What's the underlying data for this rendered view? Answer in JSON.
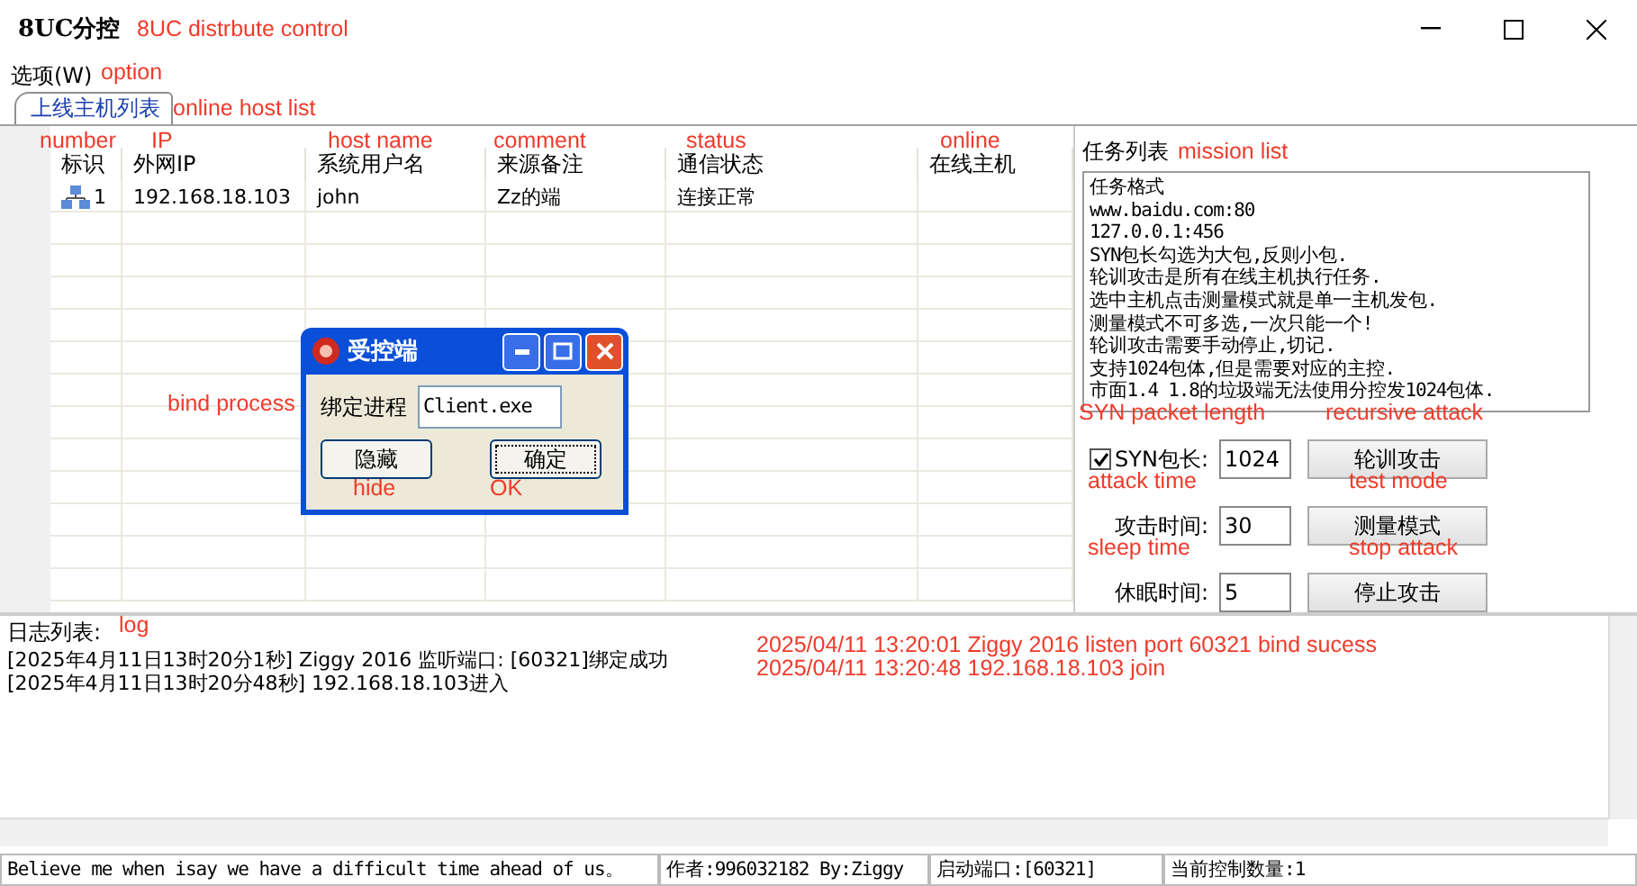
{
  "window": {
    "title": "8UC分控"
  },
  "menu": [
    "选项(W)"
  ],
  "tabs": [
    {
      "label": "上线主机列表",
      "selected": true
    }
  ],
  "table": {
    "columns": [
      "标识",
      "外网IP",
      "系统用户名",
      "来源备注",
      "通信状态",
      "在线主机"
    ],
    "rows": [
      {
        "cells": [
          "1",
          "192.168.18.103",
          "john",
          "Zz的端",
          "连接正常",
          ""
        ]
      }
    ]
  },
  "mission": {
    "label": "任务列表",
    "lines": [
      "任务格式",
      "www.baidu.com:80",
      "127.0.0.1:456",
      "SYN包长勾选为大包,反则小包.",
      "轮训攻击是所有在线主机执行任务.",
      "选中主机点击测量模式就是单一主机发包.",
      "测量模式不可多选,一次只能一个!",
      "轮训攻击需要手动停止,切记.",
      "支持1024包体,但是需要对应的主控.",
      "市面1.4 1.8的垃圾端无法使用分控发1024包体."
    ]
  },
  "controls": [
    {
      "kind": "checkbox",
      "label": "SYN包长:",
      "checked": true,
      "value": "1024",
      "button": "轮训攻击"
    },
    {
      "kind": "text",
      "label": "攻击时间:",
      "value": "30",
      "button": "测量模式"
    },
    {
      "kind": "text",
      "label": "休眠时间:",
      "value": "5",
      "button": "停止攻击"
    }
  ],
  "log": {
    "label": "日志列表:",
    "lines": [
      "[2025年4月11日13时20分1秒]  Ziggy  2016  监听端口: [60321]绑定成功",
      "[2025年4月11日13时20分48秒]  192.168.18.103进入"
    ]
  },
  "status_bar": [
    "Believe me when isay we have a difficult time ahead of us。",
    "作者:996032182  By:Ziggy",
    "启动端口:[60321]",
    "当前控制数量:1"
  ],
  "dialog": {
    "title": "受控端",
    "field_label": "绑定进程",
    "field_value": "Client.exe",
    "buttons": [
      "隐藏",
      "确定"
    ]
  },
  "annotations": [
    "8UC distrbute control",
    "option",
    "online host list",
    "number",
    "IP",
    "host name",
    "comment",
    "status",
    "online",
    "mission list",
    "bind process",
    "hide",
    "OK",
    "SYN packet length",
    "recursive attack",
    "attack time",
    "test mode",
    "sleep time",
    "stop attack",
    "log",
    "2025/04/11 13:20:01 Ziggy 2016 listen port 60321 bind sucess",
    "2025/04/11 13:20:48 192.168.18.103 join"
  ]
}
